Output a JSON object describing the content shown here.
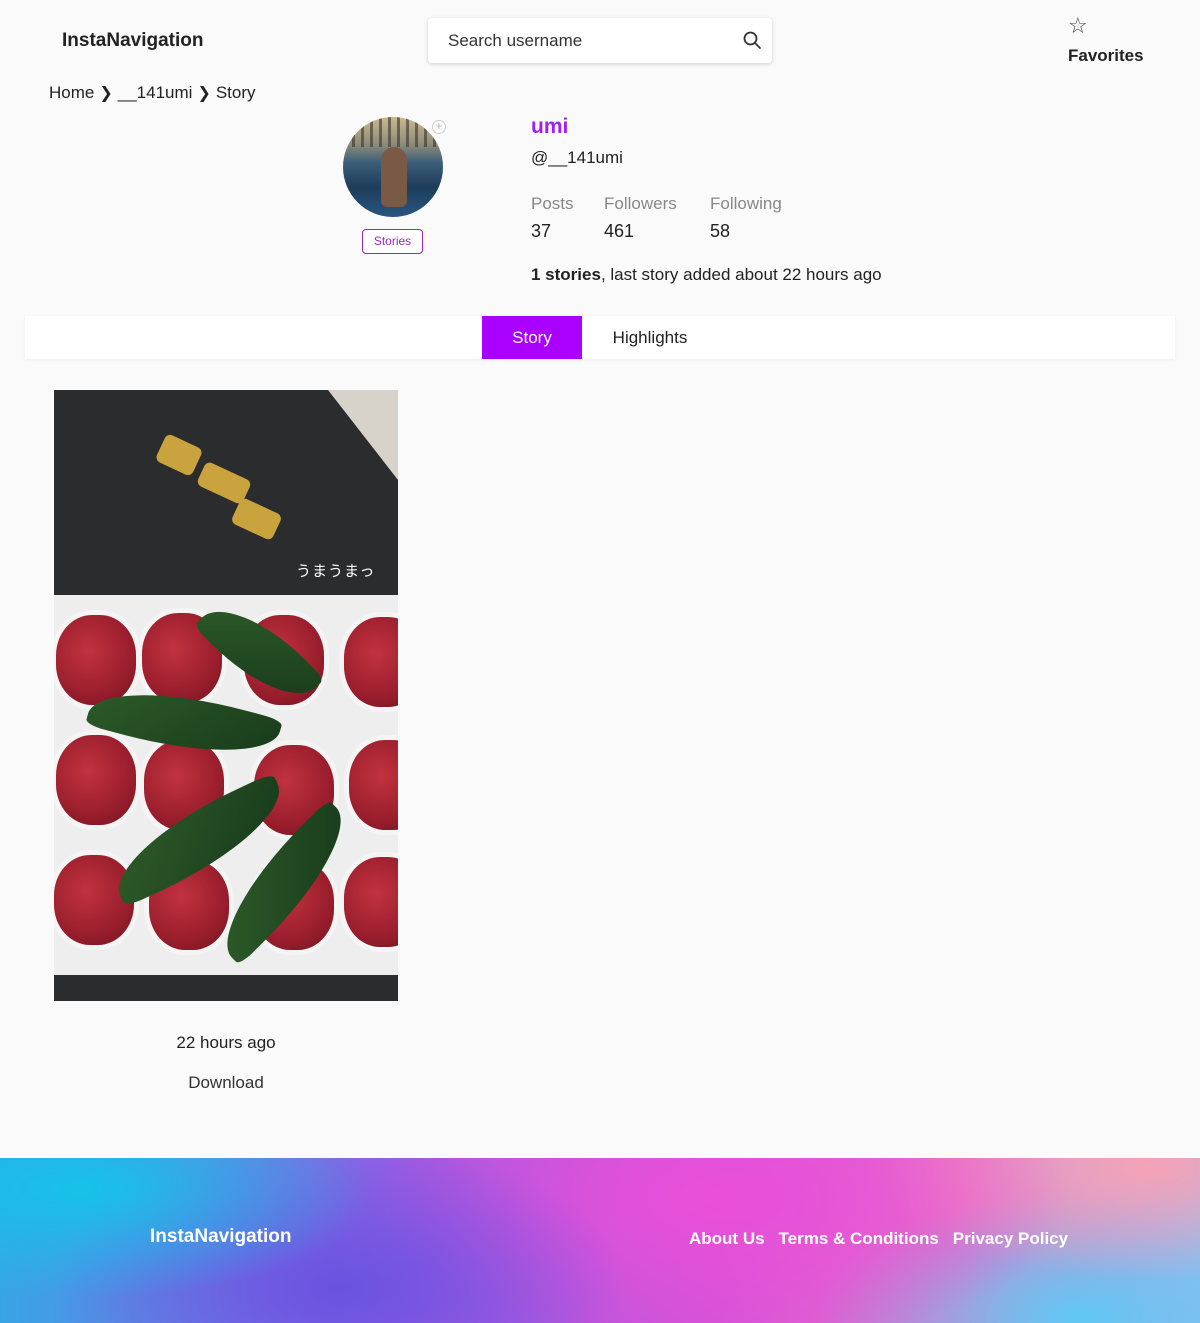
{
  "header": {
    "logo": "InstaNavigation",
    "search_placeholder": "Search username",
    "favorites_label": "Favorites"
  },
  "breadcrumb": [
    "Home",
    "__141umi",
    "Story"
  ],
  "profile": {
    "display_name": "umi",
    "handle": "@__141umi",
    "stories_badge": "Stories",
    "stats": [
      {
        "label": "Posts",
        "value": "37"
      },
      {
        "label": "Followers",
        "value": "461"
      },
      {
        "label": "Following",
        "value": "58"
      }
    ],
    "summary_bold": "1 stories",
    "summary_rest": ", last story added about 22 hours ago"
  },
  "tabs": [
    {
      "label": "Story",
      "active": true
    },
    {
      "label": "Highlights",
      "active": false
    }
  ],
  "story": {
    "caption": "うまうまっ",
    "time": "22 hours ago",
    "download_label": "Download"
  },
  "footer": {
    "logo": "InstaNavigation",
    "links": [
      "About Us",
      "Terms & Conditions",
      "Privacy Policy"
    ]
  },
  "colors": {
    "accent": "#aa00ff",
    "display_name": "#a020f0",
    "badge": "#9c27b0"
  },
  "icons": {
    "search": "search-icon",
    "favorites": "star-outline-icon",
    "breadcrumb_separator": "chevron-right-icon",
    "avatar_add": "plus-circle-icon"
  }
}
